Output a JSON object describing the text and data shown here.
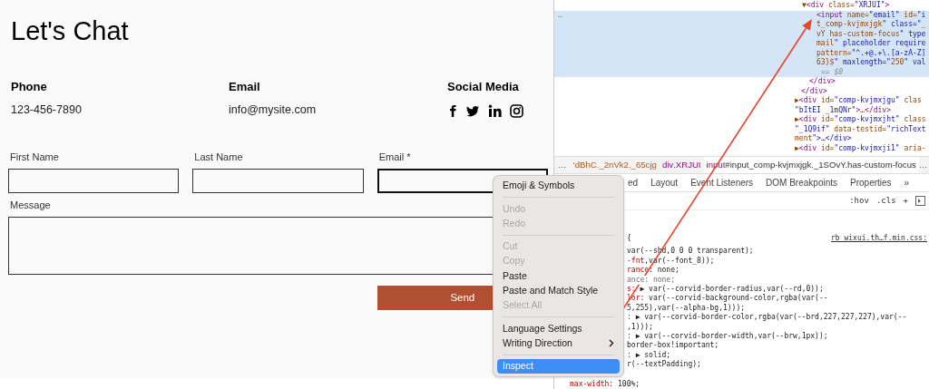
{
  "page": {
    "title": "Let's Chat",
    "info": [
      {
        "heading": "Phone",
        "value": "123-456-7890"
      },
      {
        "heading": "Email",
        "value": "info@mysite.com"
      },
      {
        "heading": "Social Media",
        "kind": "social"
      }
    ],
    "form": {
      "fields": [
        {
          "label": "First Name",
          "focused": false
        },
        {
          "label": "Last Name",
          "focused": false
        },
        {
          "label": "Email *",
          "focused": true
        }
      ],
      "message_label": "Message",
      "submit": "Send"
    }
  },
  "context_menu": [
    {
      "kind": "item",
      "label": "Emoji & Symbols",
      "disabled": false,
      "selected": false,
      "has_submenu": false
    },
    {
      "kind": "separator"
    },
    {
      "kind": "item",
      "label": "Undo",
      "disabled": true,
      "selected": false,
      "has_submenu": false
    },
    {
      "kind": "item",
      "label": "Redo",
      "disabled": true,
      "selected": false,
      "has_submenu": false
    },
    {
      "kind": "separator"
    },
    {
      "kind": "item",
      "label": "Cut",
      "disabled": true,
      "selected": false,
      "has_submenu": false
    },
    {
      "kind": "item",
      "label": "Copy",
      "disabled": true,
      "selected": false,
      "has_submenu": false
    },
    {
      "kind": "item",
      "label": "Paste",
      "disabled": false,
      "selected": false,
      "has_submenu": false
    },
    {
      "kind": "item",
      "label": "Paste and Match Style",
      "disabled": false,
      "selected": false,
      "has_submenu": false
    },
    {
      "kind": "item",
      "label": "Select All",
      "disabled": true,
      "selected": false,
      "has_submenu": false
    },
    {
      "kind": "separator"
    },
    {
      "kind": "item",
      "label": "Language Settings",
      "disabled": false,
      "selected": false,
      "has_submenu": false
    },
    {
      "kind": "item",
      "label": "Writing Direction",
      "disabled": false,
      "selected": false,
      "has_submenu": true
    },
    {
      "kind": "separator"
    },
    {
      "kind": "item",
      "label": "Inspect",
      "disabled": false,
      "selected": true,
      "has_submenu": false
    }
  ],
  "devtools": {
    "gutter": "…",
    "dom_lines": [
      {
        "kind": "parent",
        "text": "▼<div class=\"XRJUI\">",
        "selected": false
      },
      {
        "kind": "child",
        "text": "<input name=\"email\" id=\"i",
        "selected": true
      },
      {
        "kind": "child",
        "text": "t_comp-kvjmxjgk\" class=\"_",
        "selected": true
      },
      {
        "kind": "child",
        "text": "vY has-custom-focus\" type",
        "selected": true
      },
      {
        "kind": "child",
        "text": "mail\" placeholder require",
        "selected": true
      },
      {
        "kind": "child",
        "text": "pattern=\"^.+@.+\\.[a-zA-Z]",
        "selected": true
      },
      {
        "kind": "child",
        "text": "63}$\" maxlength=\"250\" val",
        "selected": true
      },
      {
        "kind": "marker",
        "text": "== $0",
        "selected": true
      },
      {
        "kind": "close-inner",
        "text": "</div>",
        "selected": false
      },
      {
        "kind": "close-outer",
        "text": "</div>",
        "selected": false
      },
      {
        "kind": "sibling",
        "text": "▶<div id=\"comp-kvjmxjgu\" clas",
        "selected": false
      },
      {
        "kind": "sibling",
        "text": "\"bItEI _1mQNr\">…</div>",
        "selected": false
      },
      {
        "kind": "sibling",
        "text": "▶<div id=\"comp-kvjmxjht\" class",
        "selected": false
      },
      {
        "kind": "sibling",
        "text": "\"_1Q9if\" data-testid=\"richText",
        "selected": false
      },
      {
        "kind": "sibling",
        "text": "ment\">…</div>",
        "selected": false
      },
      {
        "kind": "sibling",
        "text": "▶<div id=\"comp-kvjmxji1\" aria-",
        "selected": false
      }
    ],
    "breadcrumbs": {
      "lead": "…",
      "items": [
        {
          "selector": "‘dBhC._2nVk2._65cjg",
          "selected": false
        },
        {
          "tag": "div",
          "selector": ".XRJUI",
          "selected": false
        },
        {
          "tag": "input",
          "selector": "#input_comp-kvjmxjgk._1SOvY.has-custom-focus",
          "selected": true
        }
      ],
      "trail": "…"
    },
    "tabs": [
      "ed",
      "Layout",
      "Event Listeners",
      "DOM Breakpoints",
      "Properties",
      "»"
    ],
    "filter_buttons": [
      ":hov",
      ".cls",
      "+"
    ],
    "rule": {
      "selector_tail": " {",
      "source": "rb_wixui.th…f.min.css:"
    },
    "style_lines": [
      {
        "value": "var(--shd,0 0 0 transparent);",
        "struck": false
      },
      {
        "prop": "-fnt",
        "value": ",var(--font_8));",
        "struck": false
      },
      {
        "prop": "rance",
        "value": ": none;",
        "struck": false
      },
      {
        "value": "ance: none;",
        "struck": true
      },
      {
        "prop": "s:",
        "value": " ▶ var(--corvid-border-radius,var(--rd,0));",
        "struck": false
      },
      {
        "prop": "lor:",
        "value": " var(--corvid-background-color,rgba(var(--",
        "struck": false
      },
      {
        "value": "5,255),var(--alpha-bg,1)));",
        "struck": false
      },
      {
        "prop": ":",
        "value": " ▶ var(--corvid-border-color,rgba(var(--brd,227,227,227),var(--",
        "struck": false
      },
      {
        "value": ",1)));",
        "struck": false
      },
      {
        "prop": ":",
        "value": " ▶ var(--corvid-border-width,var(--brw,1px));",
        "struck": false
      },
      {
        "value": "border-box!important;",
        "struck": false
      },
      {
        "prop": ":",
        "value": " ▶ solid;",
        "struck": false
      },
      {
        "value": "r(--textPadding);",
        "struck": false
      }
    ],
    "last_line": {
      "prop": "max-width",
      "value": ": 100%;"
    }
  }
}
